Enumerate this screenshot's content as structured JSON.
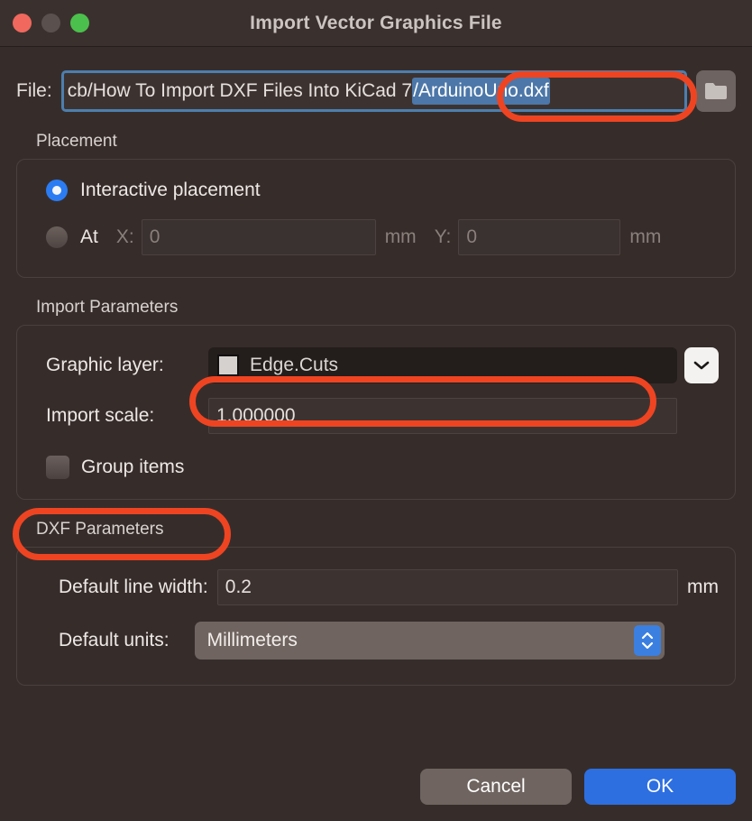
{
  "window": {
    "title": "Import Vector Graphics File",
    "traffic_lights": [
      "close-red",
      "minimize-gray",
      "zoom-green"
    ]
  },
  "file": {
    "label": "File:",
    "path_plain": "cb/How To Import DXF Files Into KiCad 7",
    "path_selected": "/ArduinoUno.dxf",
    "browse_icon": "folder-icon"
  },
  "placement": {
    "group_title": "Placement",
    "interactive_label": "Interactive placement",
    "interactive_selected": true,
    "at_label": "At",
    "at_selected": false,
    "x_label": "X:",
    "x_value": "0",
    "x_unit": "mm",
    "y_label": "Y:",
    "y_value": "0",
    "y_unit": "mm"
  },
  "import_parameters": {
    "group_title": "Import Parameters",
    "graphic_layer_label": "Graphic layer:",
    "graphic_layer_value": "Edge.Cuts",
    "graphic_layer_swatch_color": "#D5D1CE",
    "import_scale_label": "Import scale:",
    "import_scale_value": "1.000000",
    "group_items_label": "Group items",
    "group_items_checked": false
  },
  "dxf_parameters": {
    "group_title": "DXF Parameters",
    "line_width_label": "Default line width:",
    "line_width_value": "0.2",
    "line_width_unit": "mm",
    "units_label": "Default units:",
    "units_value": "Millimeters"
  },
  "footer": {
    "cancel_label": "Cancel",
    "ok_label": "OK"
  },
  "colors": {
    "accent_blue": "#2D6FE0",
    "annotation_red": "#EE4422",
    "window_bg": "#362D2B",
    "titlebar_bg": "#3A312E",
    "selection_blue": "#4C77A8"
  }
}
